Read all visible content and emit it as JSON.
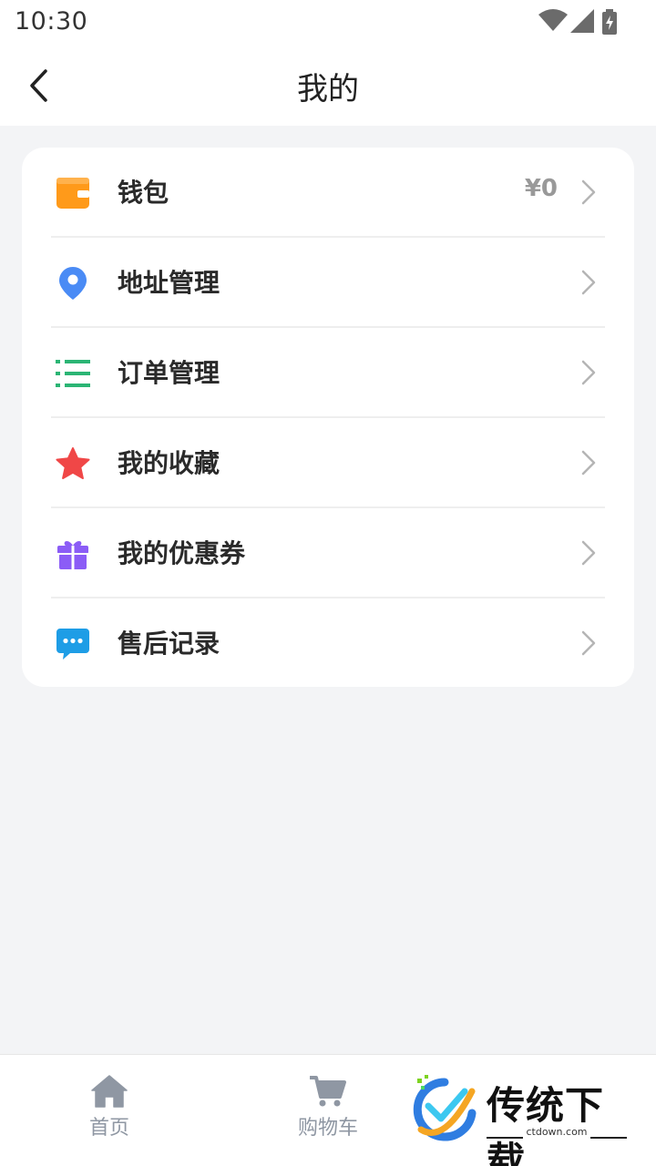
{
  "status_bar": {
    "time": "10:30"
  },
  "header": {
    "title": "我的"
  },
  "menu": [
    {
      "id": "wallet",
      "label": "钱包",
      "value": "¥0",
      "icon": "wallet-icon",
      "color": "#ff9a1a"
    },
    {
      "id": "address",
      "label": "地址管理",
      "value": "",
      "icon": "location-pin-icon",
      "color": "#4a8bf5"
    },
    {
      "id": "orders",
      "label": "订单管理",
      "value": "",
      "icon": "list-icon",
      "color": "#2bb574"
    },
    {
      "id": "favorites",
      "label": "我的收藏",
      "value": "",
      "icon": "star-icon",
      "color": "#f04747"
    },
    {
      "id": "coupons",
      "label": "我的优惠券",
      "value": "",
      "icon": "gift-icon",
      "color": "#8b5cf6"
    },
    {
      "id": "after_sales",
      "label": "售后记录",
      "value": "",
      "icon": "chat-bubble-icon",
      "color": "#1e9de6"
    }
  ],
  "tabbar": {
    "home": {
      "label": "首页",
      "icon": "home-icon"
    },
    "cart": {
      "label": "购物车",
      "icon": "cart-icon"
    }
  },
  "watermark": {
    "text": "传统下载",
    "sub": "ctdown.com"
  },
  "colors": {
    "background": "#f3f4f6",
    "card": "#ffffff",
    "tab_inactive": "#8f97a3"
  }
}
